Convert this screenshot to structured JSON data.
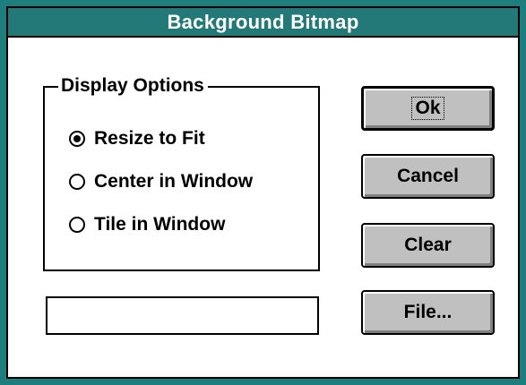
{
  "window": {
    "title": "Background Bitmap"
  },
  "display_options": {
    "group_label": "Display Options",
    "options": [
      {
        "label": "Resize to Fit",
        "checked": true
      },
      {
        "label": "Center in Window",
        "checked": false
      },
      {
        "label": "Tile in Window",
        "checked": false
      }
    ]
  },
  "filename_field": {
    "value": ""
  },
  "buttons": {
    "ok": "Ok",
    "cancel": "Cancel",
    "clear": "Clear",
    "file": "File..."
  },
  "colors": {
    "title_bar": "#237878",
    "frame": "#1e7e7e",
    "button_face": "#c0c0c0"
  }
}
